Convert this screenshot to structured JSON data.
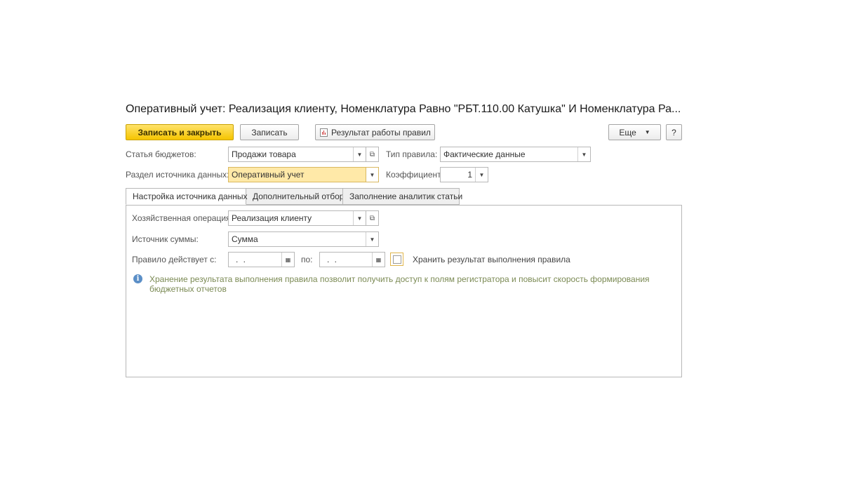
{
  "window": {
    "title": "Оперативный учет: Реализация клиенту, Номенклатура Равно \"РБТ.110.00 Катушка\" И Номенклатура Ра..."
  },
  "toolbar": {
    "save_close_label": "Записать и закрыть",
    "save_label": "Записать",
    "rules_result_label": "Результат работы правил",
    "more_label": "Еще",
    "help_label": "?"
  },
  "form": {
    "budget_article": {
      "label": "Статья бюджетов:",
      "value": "Продажи товара"
    },
    "rule_type": {
      "label": "Тип правила:",
      "value": "Фактические данные"
    },
    "data_source_section": {
      "label": "Раздел источника данных:",
      "value": "Оперативный учет"
    },
    "coefficient": {
      "label": "Коэффициент:",
      "value": "1"
    }
  },
  "tabs": [
    {
      "label": "Настройка источника данных",
      "active": true
    },
    {
      "label": "Дополнительный отбор",
      "active": false
    },
    {
      "label": "Заполнение аналитик статьи",
      "active": false
    }
  ],
  "source_settings": {
    "business_operation": {
      "label": "Хозяйственная операция:",
      "value": "Реализация клиенту"
    },
    "amount_source": {
      "label": "Источник суммы:",
      "value": "Сумма"
    },
    "rule_valid_from": {
      "label": "Правило действует с:",
      "value": " .  . "
    },
    "rule_valid_to": {
      "label": "по:",
      "value": " .  . "
    },
    "store_result": {
      "label": "Хранить результат выполнения правила",
      "checked": false
    },
    "info_text": "Хранение результата выполнения правила позволит получить доступ к полям регистратора и повысит скорость формирования бюджетных отчетов"
  },
  "icons": {
    "dropdown": "chevron-down-icon",
    "open": "open-form-icon",
    "calendar": "calendar-icon",
    "report": "report-icon",
    "info": "info-icon"
  },
  "colors": {
    "primary_button": "#f5c400",
    "highlight_field": "#ffe9a8",
    "info_text": "#7b8a54",
    "info_icon": "#5b8fc7"
  }
}
